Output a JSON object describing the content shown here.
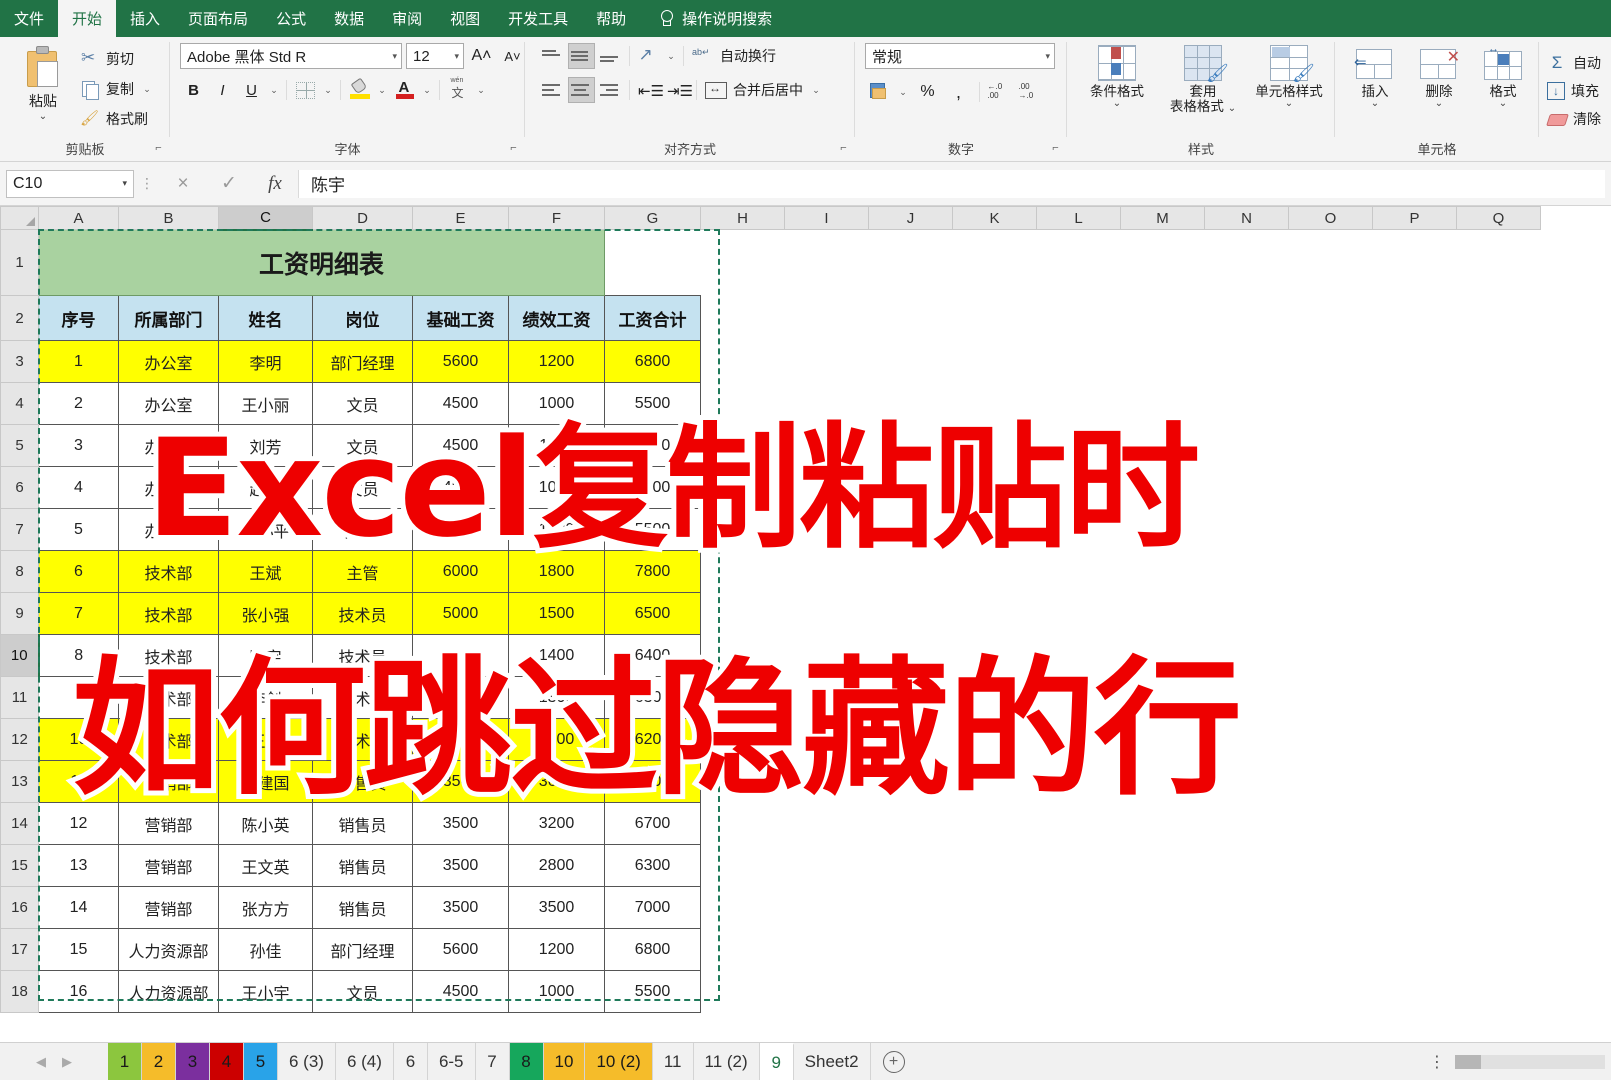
{
  "ribbon": {
    "tabs": [
      {
        "label": "文件",
        "active": false
      },
      {
        "label": "开始",
        "active": true
      },
      {
        "label": "插入",
        "active": false
      },
      {
        "label": "页面布局",
        "active": false
      },
      {
        "label": "公式",
        "active": false
      },
      {
        "label": "数据",
        "active": false
      },
      {
        "label": "审阅",
        "active": false
      },
      {
        "label": "视图",
        "active": false
      },
      {
        "label": "开发工具",
        "active": false
      },
      {
        "label": "帮助",
        "active": false
      }
    ],
    "search_placeholder": "操作说明搜索",
    "groups": {
      "clipboard": {
        "caption": "剪贴板",
        "paste": "粘贴",
        "cut": "剪切",
        "copy": "复制",
        "format_painter": "格式刷"
      },
      "font": {
        "caption": "字体",
        "font_name": "Adobe 黑体 Std R",
        "font_size": "12",
        "bold": "B",
        "italic": "I",
        "underline": "U"
      },
      "alignment": {
        "caption": "对齐方式",
        "wrap_text": "自动换行",
        "merge_center": "合并后居中"
      },
      "number": {
        "caption": "数字",
        "format": "常规",
        "percent": "%",
        "comma": ","
      },
      "styles": {
        "caption": "样式",
        "conditional": "条件格式",
        "table_format_l1": "套用",
        "table_format_l2": "表格格式",
        "cell_styles": "单元格样式"
      },
      "cells": {
        "caption": "单元格",
        "insert": "插入",
        "delete": "删除",
        "format": "格式"
      },
      "editing": {
        "autosum": "自动",
        "fill": "填充",
        "clear": "清除"
      }
    }
  },
  "formula_bar": {
    "name_box": "C10",
    "cancel_icon": "×",
    "enter_icon": "✓",
    "fx_icon": "fx",
    "value": "陈宇"
  },
  "sheet": {
    "columns": [
      "A",
      "B",
      "C",
      "D",
      "E",
      "F",
      "G",
      "H",
      "I",
      "J",
      "K",
      "L",
      "M",
      "N",
      "O",
      "P",
      "Q"
    ],
    "selected_column": "C",
    "selected_row": "10",
    "rows_visible": [
      "1",
      "2",
      "3",
      "4",
      "5",
      "6",
      "7",
      "8",
      "9",
      "10",
      "11",
      "12",
      "13",
      "14",
      "15",
      "16",
      "17",
      "18"
    ],
    "title": "工资明细表",
    "headers": [
      "序号",
      "所属部门",
      "姓名",
      "岗位",
      "基础工资",
      "绩效工资",
      "工资合计"
    ],
    "data": [
      {
        "row": "3",
        "cells": [
          "1",
          "办公室",
          "李明",
          "部门经理",
          "5600",
          "1200",
          "6800"
        ],
        "highlight": true
      },
      {
        "row": "4",
        "cells": [
          "2",
          "办公室",
          "王小丽",
          "文员",
          "4500",
          "1000",
          "5500"
        ],
        "highlight": false
      },
      {
        "row": "5",
        "cells": [
          "3",
          "办公室",
          "刘芳",
          "文员",
          "4500",
          "1100",
          "5600"
        ],
        "highlight": false
      },
      {
        "row": "6",
        "cells": [
          "4",
          "办公室",
          "赵云",
          "文员",
          "4500",
          "1000",
          "5500"
        ],
        "highlight": false
      },
      {
        "row": "7",
        "cells": [
          "5",
          "办公室",
          "周小平",
          "干事员",
          "4500",
          "1000",
          "5500"
        ],
        "highlight": false
      },
      {
        "row": "8",
        "cells": [
          "6",
          "技术部",
          "王斌",
          "主管",
          "6000",
          "1800",
          "7800"
        ],
        "highlight": true
      },
      {
        "row": "9",
        "cells": [
          "7",
          "技术部",
          "张小强",
          "技术员",
          "5000",
          "1500",
          "6500"
        ],
        "highlight": true
      },
      {
        "row": "10",
        "cells": [
          "8",
          "技术部",
          "陈宇",
          "技术员",
          "5000",
          "1400",
          "6400"
        ],
        "highlight": false
      },
      {
        "row": "11",
        "cells": [
          "9",
          "技术部",
          "李剑",
          "技术员",
          "5000",
          "1300",
          "6300"
        ],
        "highlight": false
      },
      {
        "row": "12",
        "cells": [
          "10",
          "技术部",
          "王强",
          "技术员",
          "5000",
          "1200",
          "6200"
        ],
        "highlight": true
      },
      {
        "row": "13",
        "cells": [
          "11",
          "营销部",
          "陈建国",
          "销售员",
          "3500",
          "3600",
          "7100"
        ],
        "highlight": true
      },
      {
        "row": "14",
        "cells": [
          "12",
          "营销部",
          "陈小英",
          "销售员",
          "3500",
          "3200",
          "6700"
        ],
        "highlight": false
      },
      {
        "row": "15",
        "cells": [
          "13",
          "营销部",
          "王文英",
          "销售员",
          "3500",
          "2800",
          "6300"
        ],
        "highlight": false
      },
      {
        "row": "16",
        "cells": [
          "14",
          "营销部",
          "张方方",
          "销售员",
          "3500",
          "3500",
          "7000"
        ],
        "highlight": false
      },
      {
        "row": "17",
        "cells": [
          "15",
          "人力资源部",
          "孙佳",
          "部门经理",
          "5600",
          "1200",
          "6800"
        ],
        "highlight": false
      },
      {
        "row": "18",
        "cells": [
          "16",
          "人力资源部",
          "王小宇",
          "文员",
          "4500",
          "1000",
          "5500"
        ],
        "highlight": false
      }
    ],
    "colors": {
      "title_fill": "#a9d2a0",
      "header_fill": "#c5e2f0",
      "highlight_fill": "#ffff00",
      "marquee": "#1f7a5a"
    }
  },
  "overlay": {
    "line1": "Excel复制粘贴时",
    "line2": "如何跳过隐藏的行",
    "color": "#ee0000"
  },
  "sheet_tabs": {
    "items": [
      {
        "label": "1",
        "color": "#8cc63e",
        "active": false
      },
      {
        "label": "2",
        "color": "#f5bc2a",
        "active": false
      },
      {
        "label": "3",
        "color": "#7b2f9e",
        "active": false
      },
      {
        "label": "4",
        "color": "#cc0000",
        "active": false
      },
      {
        "label": "5",
        "color": "#29a3e8",
        "active": false
      },
      {
        "label": "6 (3)",
        "color": "",
        "active": false
      },
      {
        "label": "6 (4)",
        "color": "",
        "active": false
      },
      {
        "label": "6",
        "color": "",
        "active": false
      },
      {
        "label": "6-5",
        "color": "",
        "active": false
      },
      {
        "label": "7",
        "color": "",
        "active": false
      },
      {
        "label": "8",
        "color": "#16a75c",
        "active": false
      },
      {
        "label": "10",
        "color": "#f5bc2a",
        "active": false
      },
      {
        "label": "10 (2)",
        "color": "#f5bc2a",
        "active": false
      },
      {
        "label": "11",
        "color": "",
        "active": false
      },
      {
        "label": "11 (2)",
        "color": "",
        "active": false
      },
      {
        "label": "9",
        "color": "",
        "active": true
      },
      {
        "label": "Sheet2",
        "color": "",
        "active": false
      }
    ],
    "add_label": "+"
  }
}
